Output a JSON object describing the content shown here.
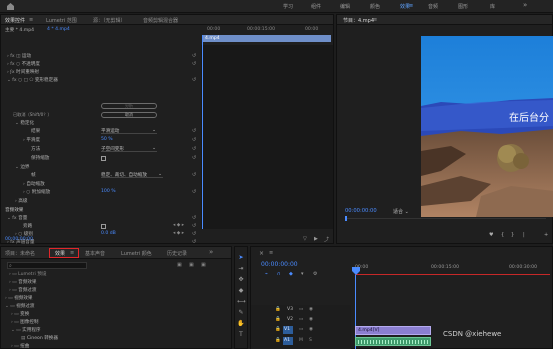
{
  "topbar": {
    "items": [
      "学习",
      "组件",
      "编辑",
      "颜色",
      "效果",
      "音频",
      "图形",
      "库"
    ],
    "active": "效果",
    "more": "»"
  },
  "effect_controls": {
    "tabs": [
      "效果控件",
      "Lumetri 范围",
      "源：（无剪辑）",
      "音频剪辑混合器"
    ],
    "source": "主要 * 4.mp4",
    "clip": "4 * 4.mp4",
    "timecode_ruler": [
      "00:00",
      "00:00:15:00",
      "00:00"
    ],
    "clip_bar": "4.mp4",
    "video_effects_header": "视频效果",
    "rows": {
      "motion": "运动",
      "opacity": "不透明度",
      "time_remap": "时间重映射",
      "warp_stabilizer": "变形稳定器",
      "analyze_btn": "分析",
      "status": "已取消（Shift/0？）",
      "cancel_btn": "取消",
      "stabilization": "稳定化",
      "result_label": "结果",
      "result_value": "平滑运动",
      "smoothness_label": "平滑度",
      "smoothness_value": "50 %",
      "method_label": "方法",
      "method_value": "子空间变形",
      "preserve_scale": "保持缩放",
      "borders": "边界",
      "framing_label": "帧",
      "framing_value": "稳定、裁切、自动缩放",
      "auto_scale": "自动缩放",
      "additional_scale_label": "附加缩放",
      "additional_scale_value": "100 %",
      "advanced": "高级",
      "audio_effects_header": "音频效果",
      "volume": "音量",
      "bypass": "旁路",
      "level_label": "级别",
      "level_value": "0.0 dB",
      "channel_volume": "声道音量",
      "panner": "声像器"
    },
    "timecode": "00:00:00:00"
  },
  "program": {
    "title": "节目：4.mp4",
    "overlay_text": "在后台分",
    "timecode": "00:00:00:00",
    "fit": "适合",
    "controls": [
      "{",
      "}",
      "|",
      "◀",
      "▶",
      "+"
    ]
  },
  "project": {
    "tabs": [
      "项目：未命名",
      "效果",
      "基本声音",
      "Lumetri 颜色",
      "历史记录"
    ],
    "active_tab": "效果",
    "search_placeholder": "",
    "tree": [
      "Lumetri 预设",
      "音频效果",
      "音频过渡",
      "视频效果",
      "视频过渡",
      "变换",
      "图像控制",
      "实用程序",
      "Cineon 转换器",
      "扭曲"
    ]
  },
  "timeline": {
    "timecode": "00:00:00:00",
    "ruler": [
      "00:00",
      "00:00:15:00",
      "00:00:30:00"
    ],
    "tracks": [
      {
        "name": "V3"
      },
      {
        "name": "V2"
      },
      {
        "name": "V1",
        "clip": "4.mp4[V]"
      },
      {
        "name": "A1",
        "clip": ""
      }
    ],
    "watermark": "CSDN @xiehewe"
  },
  "colors": {
    "accent": "#4a8bff",
    "highlight_box": "#e0262a",
    "playhead": "#4a8bff",
    "clip_purple": "#8b7fd0",
    "clip_green": "#3f9a6b"
  }
}
